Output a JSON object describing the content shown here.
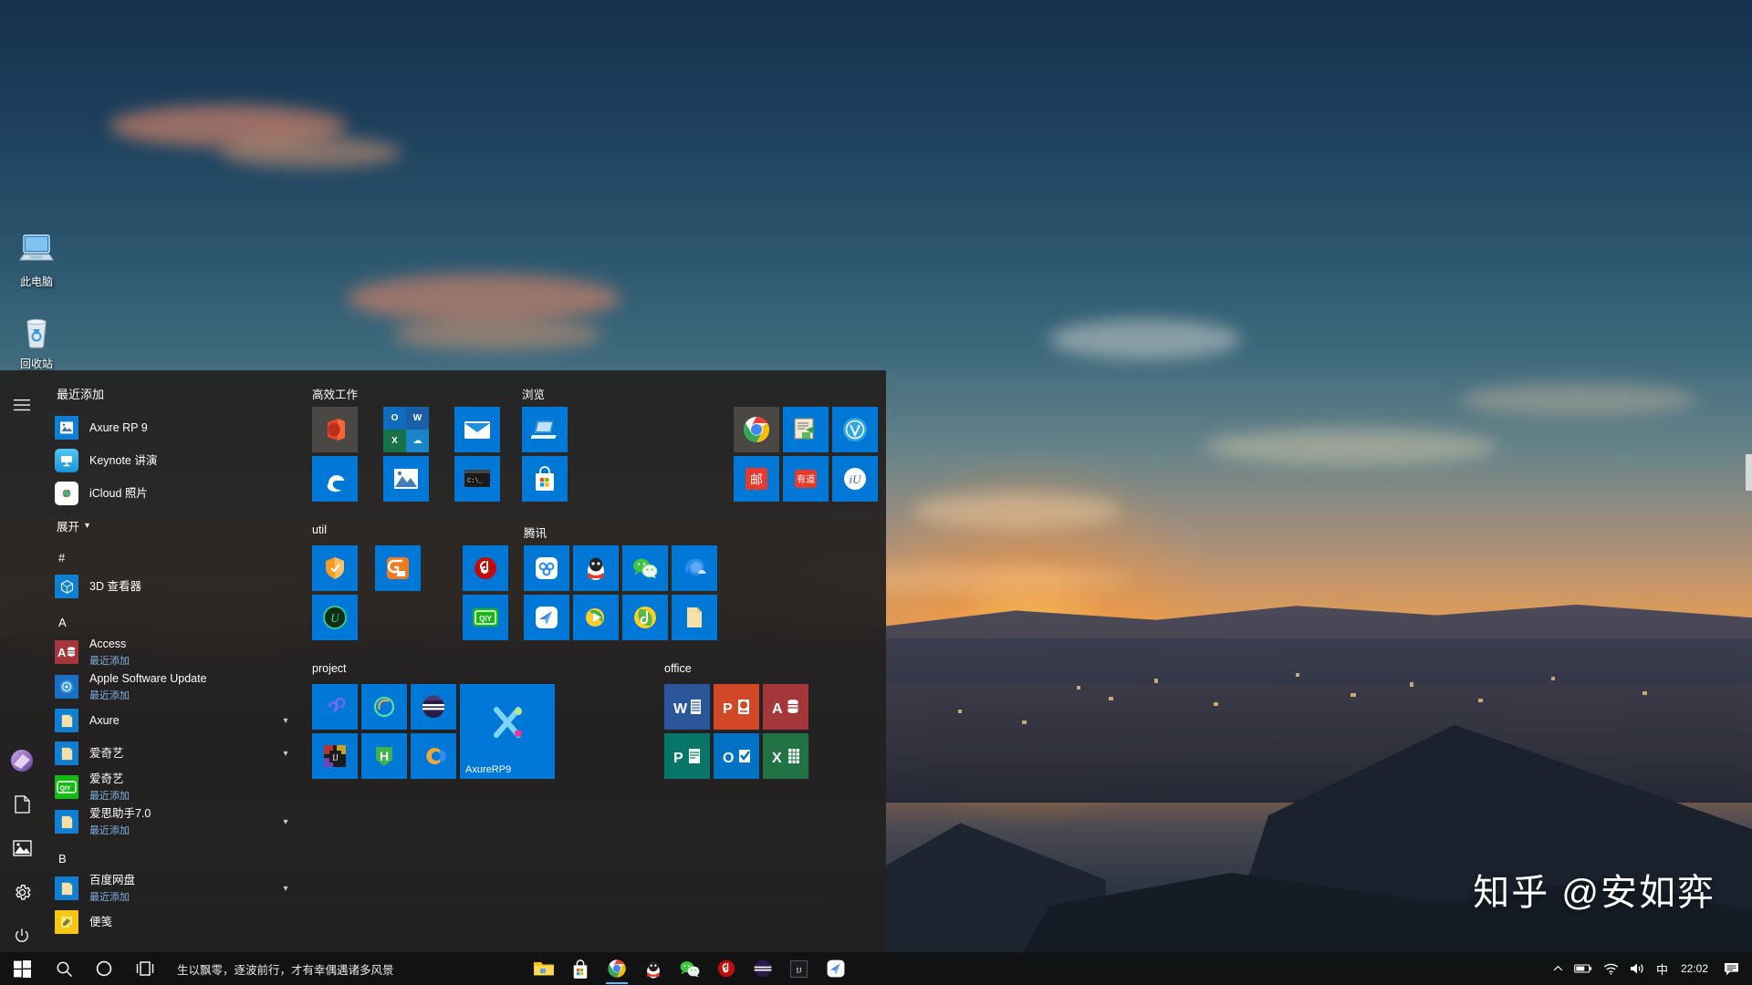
{
  "desktop": {
    "icons": [
      {
        "label": "此电脑",
        "icon": "this-pc-icon"
      },
      {
        "label": "回收站",
        "icon": "recycle-bin-icon"
      }
    ],
    "watermark": "知乎 @安如弈"
  },
  "start_menu": {
    "rail": [
      {
        "name": "hamburger-icon",
        "glyph": "☰"
      },
      {
        "name": "user-avatar-icon",
        "glyph": "●"
      },
      {
        "name": "documents-icon",
        "glyph": "📄"
      },
      {
        "name": "pictures-icon",
        "glyph": "🖼"
      },
      {
        "name": "settings-gear-icon",
        "glyph": "⚙"
      },
      {
        "name": "power-icon",
        "glyph": "⏻"
      }
    ],
    "app_list": {
      "recently_added_header": "最近添加",
      "expand_label": "展开",
      "recently_added": [
        {
          "name": "Axure RP 9",
          "icon": "axure-rp9-icon",
          "color": "#0f7fd4",
          "glyph": "🖼"
        },
        {
          "name": "Keynote 讲演",
          "icon": "keynote-icon",
          "color": "#2fa8e8",
          "glyph": "📊"
        },
        {
          "name": "iCloud 照片",
          "icon": "icloud-photos-icon",
          "color": "#ffffff",
          "glyph": "✿"
        }
      ],
      "sections": [
        {
          "letter": "#",
          "items": [
            {
              "name": "3D 查看器",
              "sub": "",
              "icon": "3d-viewer-icon",
              "color": "#0f7fd4",
              "glyph": "⬡",
              "chevron": false
            }
          ]
        },
        {
          "letter": "A",
          "items": [
            {
              "name": "Access",
              "sub": "最近添加",
              "icon": "access-icon",
              "color": "#a4373a",
              "glyph": "A",
              "chevron": false
            },
            {
              "name": "Apple Software Update",
              "sub": "最近添加",
              "icon": "apple-software-update-icon",
              "color": "#1a6fc4",
              "glyph": "◎",
              "chevron": false
            },
            {
              "name": "Axure",
              "sub": "",
              "icon": "folder-icon",
              "color": "#0f7fd4",
              "glyph": "📁",
              "chevron": true
            },
            {
              "name": "爱奇艺",
              "sub": "",
              "icon": "folder-icon",
              "color": "#0f7fd4",
              "glyph": "📁",
              "chevron": true
            },
            {
              "name": "爱奇艺",
              "sub": "最近添加",
              "icon": "iqiyi-icon",
              "color": "#16b916",
              "glyph": "QIY",
              "chevron": false
            },
            {
              "name": "爱思助手7.0",
              "sub": "最近添加",
              "icon": "folder-icon",
              "color": "#0f7fd4",
              "glyph": "📁",
              "chevron": true
            }
          ]
        },
        {
          "letter": "B",
          "items": [
            {
              "name": "百度网盘",
              "sub": "最近添加",
              "icon": "folder-icon",
              "color": "#0f7fd4",
              "glyph": "📁",
              "chevron": true
            },
            {
              "name": "便笺",
              "sub": "",
              "icon": "sticky-notes-icon",
              "color": "#f5c518",
              "glyph": "✎",
              "chevron": false
            }
          ]
        }
      ]
    },
    "tile_groups": [
      {
        "title": "高效工作",
        "columns": [
          [
            {
              "name": "office-tile",
              "glyph": "🗍",
              "bg": "#4b4745",
              "emoji": "🟠"
            },
            {
              "name": "edge-tile",
              "glyph": "e",
              "bg": "#0078d7",
              "emoji": "🌐"
            }
          ],
          [
            {
              "name": "office-suite-tile",
              "glyph": "quad",
              "bg": "#0078d7",
              "emoji": ""
            },
            {
              "name": "photos-tile",
              "glyph": "🖼",
              "bg": "#0078d7",
              "emoji": "🏞"
            }
          ],
          [
            {
              "name": "mail-tile",
              "glyph": "✉",
              "bg": "#0078d7",
              "emoji": "✉"
            },
            {
              "name": "command-prompt-tile",
              "glyph": "cmd",
              "bg": "#0078d7",
              "emoji": "⌨"
            }
          ]
        ]
      },
      {
        "title": "浏览",
        "columns": [
          [
            {
              "name": "remote-desktop-tile",
              "glyph": "💻",
              "bg": "#0078d7",
              "emoji": "💻"
            },
            {
              "name": "microsoft-store-tile",
              "glyph": "store",
              "bg": "#0078d7",
              "emoji": "🛍"
            }
          ]
        ]
      },
      {
        "title": "",
        "columns": [
          [
            {
              "name": "chrome-tile",
              "glyph": "chrome",
              "bg": "#4b4745",
              "emoji": ""
            },
            {
              "name": "youdao-dict-notes-tile",
              "glyph": "📝",
              "bg": "#0078d7",
              "emoji": "📝"
            }
          ],
          [
            {
              "name": "snipaste-tile",
              "glyph": "📋",
              "bg": "#0078d7",
              "emoji": "🗒"
            },
            {
              "name": "youdao-tile",
              "glyph": "有道",
              "bg": "#0078d7",
              "emoji": ""
            }
          ],
          [
            {
              "name": "v2-tile",
              "glyph": "V",
              "bg": "#0078d7",
              "emoji": ""
            },
            {
              "name": "iu-tile",
              "glyph": "iU",
              "bg": "#0078d7",
              "emoji": ""
            }
          ]
        ]
      },
      {
        "title": "util",
        "columns": [
          [
            {
              "name": "security-shield-tile",
              "glyph": "🛡",
              "bg": "#0078d7",
              "emoji": "🛡"
            },
            {
              "name": "uu-booster-tile",
              "glyph": "U",
              "bg": "#0078d7",
              "emoji": ""
            }
          ],
          [
            {
              "name": "gif-recorder-tile",
              "glyph": "G",
              "bg": "#0078d7",
              "emoji": ""
            },
            {
              "name": "empty-tile",
              "glyph": "",
              "bg": "transparent",
              "emoji": ""
            }
          ],
          [
            {
              "name": "netease-music-tile",
              "glyph": "♫",
              "bg": "#0078d7",
              "emoji": ""
            },
            {
              "name": "iqiyi-tile",
              "glyph": "QIY",
              "bg": "#0078d7",
              "emoji": ""
            }
          ]
        ]
      },
      {
        "title": "腾讯",
        "columns": [
          [
            {
              "name": "tencent-docs-tile",
              "glyph": "✿",
              "bg": "#0078d7",
              "emoji": ""
            },
            {
              "name": "tencent-meeting-tile",
              "glyph": "✈",
              "bg": "#0078d7",
              "emoji": ""
            }
          ],
          [
            {
              "name": "qq-tile",
              "glyph": "🐧",
              "bg": "#0078d7",
              "emoji": "🐧"
            },
            {
              "name": "tencent-video-tile",
              "glyph": "▶",
              "bg": "#0078d7",
              "emoji": ""
            }
          ],
          [
            {
              "name": "wechat-tile",
              "glyph": "💬",
              "bg": "#0078d7",
              "emoji": "💬"
            },
            {
              "name": "qq-music-tile",
              "glyph": "♪",
              "bg": "#0078d7",
              "emoji": ""
            }
          ],
          [
            {
              "name": "qq-browser-tile",
              "glyph": "Q",
              "bg": "#0078d7",
              "emoji": ""
            },
            {
              "name": "tencent-folder-tile",
              "glyph": "📁",
              "bg": "#0078d7",
              "emoji": "📁"
            }
          ]
        ]
      },
      {
        "title": "project",
        "columns": [
          [
            {
              "name": "infinity-tile",
              "glyph": "∞",
              "bg": "#0078d7",
              "emoji": ""
            },
            {
              "name": "intellij-idea-tile",
              "glyph": "IJ",
              "bg": "#0078d7",
              "emoji": ""
            }
          ],
          [
            {
              "name": "postman-tile",
              "glyph": "○",
              "bg": "#0078d7",
              "emoji": ""
            },
            {
              "name": "hbuilder-tile",
              "glyph": "H",
              "bg": "#0078d7",
              "emoji": ""
            }
          ],
          [
            {
              "name": "navicat-tile",
              "glyph": "◓",
              "bg": "#0078d7",
              "emoji": ""
            },
            {
              "name": "eclipse-tile",
              "glyph": "C",
              "bg": "#0078d7",
              "emoji": ""
            }
          ]
        ],
        "big_tile": {
          "name": "axure-rp9-big-tile",
          "label": "AxureRP9",
          "bg": "#0078d7"
        }
      },
      {
        "title": "office",
        "columns": [
          [
            {
              "name": "word-tile",
              "glyph": "W",
              "bg": "#2b579a",
              "emoji": ""
            },
            {
              "name": "publisher-tile",
              "glyph": "P",
              "bg": "#077568",
              "emoji": ""
            }
          ],
          [
            {
              "name": "powerpoint-tile",
              "glyph": "P",
              "bg": "#d24726",
              "emoji": ""
            },
            {
              "name": "outlook-tile",
              "glyph": "O",
              "bg": "#0072c6",
              "emoji": ""
            }
          ],
          [
            {
              "name": "access-tile",
              "glyph": "A",
              "bg": "#a4373a",
              "emoji": ""
            },
            {
              "name": "excel-tile",
              "glyph": "X",
              "bg": "#217346",
              "emoji": ""
            }
          ]
        ]
      }
    ]
  },
  "taskbar": {
    "start_label": "开始",
    "search_placeholder": "搜索",
    "news_text": "生以飘零，逐波前行，才有幸偶遇诸多风景",
    "pinned_apps": [
      {
        "name": "file-explorer-taskbar-icon",
        "glyph": "📁",
        "color": "#f5c518",
        "active": false
      },
      {
        "name": "microsoft-store-taskbar-icon",
        "glyph": "🛍",
        "color": "#ffffff",
        "active": false
      },
      {
        "name": "chrome-taskbar-icon",
        "glyph": "●",
        "color": "#4285f4",
        "active": true
      },
      {
        "name": "qq-taskbar-icon",
        "glyph": "🐧",
        "color": "#ffffff",
        "active": false
      },
      {
        "name": "wechat-taskbar-icon",
        "glyph": "💬",
        "color": "#2dc100",
        "active": false
      },
      {
        "name": "netease-music-taskbar-icon",
        "glyph": "♫",
        "color": "#c20c0c",
        "active": false
      },
      {
        "name": "navicat-taskbar-icon",
        "glyph": "◓",
        "color": "#2a1b4d",
        "active": false
      },
      {
        "name": "intellij-idea-taskbar-icon",
        "glyph": "IJ",
        "color": "#1b1b1b",
        "active": false
      },
      {
        "name": "tencent-meeting-taskbar-icon",
        "glyph": "✈",
        "color": "#ffffff",
        "active": false
      }
    ],
    "tray": {
      "chevron": "∧",
      "battery": "battery-icon",
      "network": "wifi-icon",
      "volume": "volume-icon",
      "ime": "中",
      "clock": "22:02",
      "notifications": "notification-icon"
    }
  }
}
